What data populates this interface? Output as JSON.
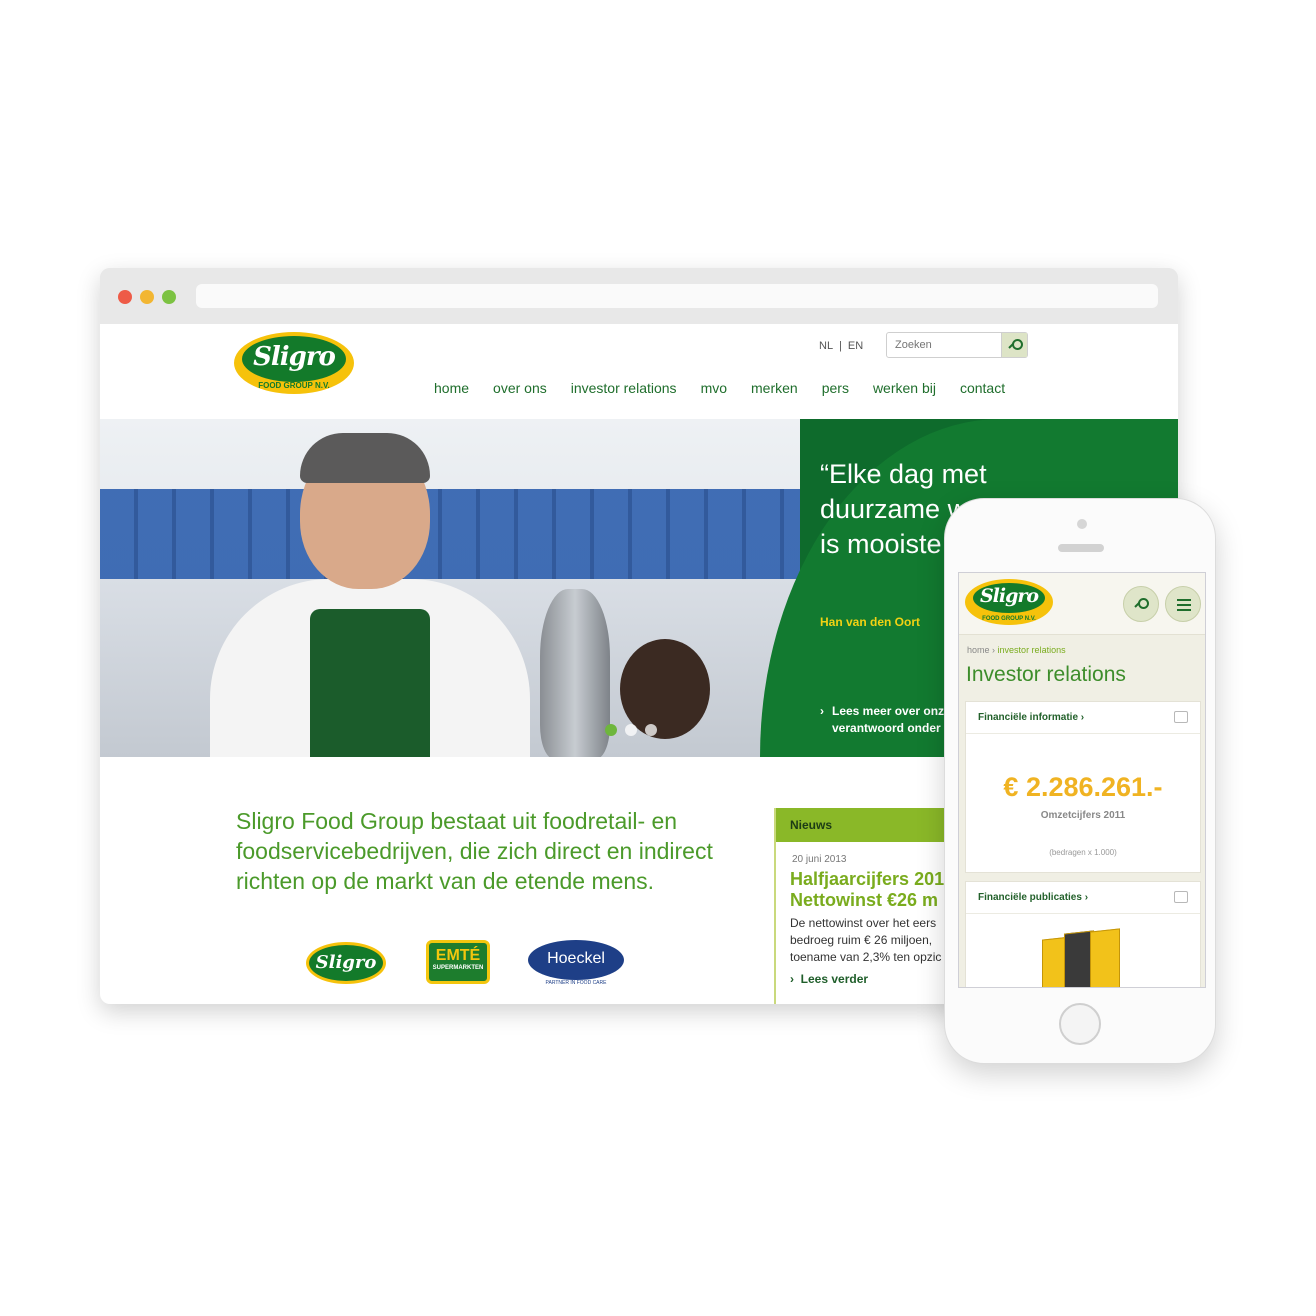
{
  "site": {
    "logo": {
      "name": "Sligro",
      "tagline": "FOOD GROUP N.V."
    },
    "lang": {
      "nl": "NL",
      "sep": "|",
      "en": "EN"
    },
    "search": {
      "placeholder": "Zoeken"
    },
    "nav": [
      "home",
      "over ons",
      "investor relations",
      "mvo",
      "merken",
      "pers",
      "werken bij",
      "contact"
    ],
    "hero": {
      "quote": "“Elke dag met duurzame werken is mooiste w",
      "author": "Han van den Oort",
      "read_more": "Lees meer over onz verantwoord onder",
      "slides": 3,
      "active_slide": 1
    },
    "intro": "Sligro Food Group bestaat uit foodretail- en foodservicebedrijven, die zich direct en indirect richten op de markt van de etende mens.",
    "brands": {
      "sligro": "Sligro",
      "emte": "EMTÉ",
      "emte_sub": "SUPERMARKTEN",
      "hoeckel": "Hoeckel",
      "hoeckel_sub": "PARTNER IN FOOD CARE"
    },
    "news": {
      "heading": "Nieuws",
      "date": "20 juni 2013",
      "title_line1": "Halfjaarcijfers 201",
      "title_line2": "Nettowinst €26 m",
      "body_line1": "De nettowinst over het eers",
      "body_line2": "bedroeg ruim € 26 miljoen,",
      "body_line3": "toename van 2,3% ten opzic",
      "more": "Lees verder"
    }
  },
  "mobile": {
    "crumb_home": "home",
    "crumb_sep": "›",
    "crumb_current": "investor relations",
    "title": "Investor relations",
    "card1": {
      "heading": "Financiële informatie ›",
      "amount": "€ 2.286.261.-",
      "label": "Omzetcijfers 2011",
      "note": "(bedragen x 1.000)"
    },
    "card2": {
      "heading": "Financiële publicaties ›"
    }
  },
  "colors": {
    "brand_green": "#127a30",
    "brand_yellow": "#f6c20b",
    "accent_lime": "#8ab828",
    "amount_orange": "#f0b322"
  }
}
